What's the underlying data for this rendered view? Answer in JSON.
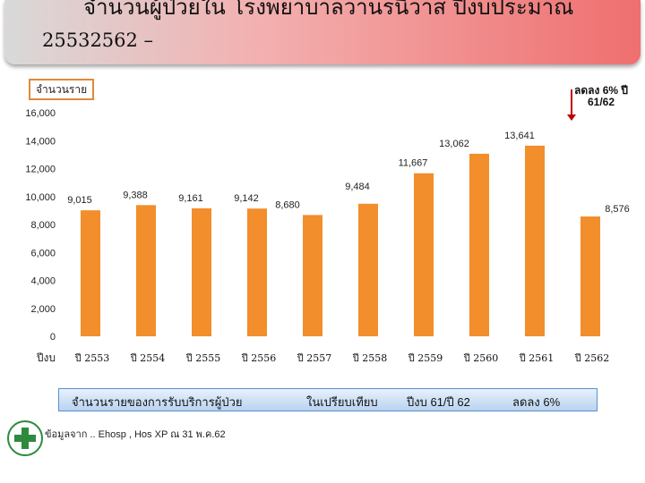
{
  "title": {
    "line1": "จำนวนผู้ป่วยใน          โรงพยาบาลวานรนิวาส   ปีงบประมาณ",
    "line2": "25532562 –"
  },
  "note": {
    "text": "ลดลง 6% ปี 61/62",
    "color": "#c00000"
  },
  "legend_text": {
    "part1": "จำนวนรายของการรับบริการผู้ป่วย",
    "part2": "ในเปรียบเทียบ",
    "part3": "ปีงบ 61/ปี 62",
    "part4": "ลดลง 6%"
  },
  "footer": {
    "source": "ข้อมูลจาก .. Ehosp , Hos XP ณ 31 พ.ค.62"
  },
  "chart_data": {
    "type": "bar",
    "ylabel": "จำนวนราย",
    "xlabel": "ปีงบ",
    "ylim": [
      0,
      16000
    ],
    "yticks": [
      "0",
      "2,000",
      "4,000",
      "6,000",
      "8,000",
      "10,000",
      "12,000",
      "14,000",
      "16,000"
    ],
    "ytick_values": [
      0,
      2000,
      4000,
      6000,
      8000,
      10000,
      12000,
      14000,
      16000
    ],
    "categories": [
      "ปี 2553",
      "ปี 2554",
      "ปี 2555",
      "ปี 2556",
      "ปี 2557",
      "ปี 2558",
      "ปี 2559",
      "ปี 2560",
      "ปี 2561",
      "ปี 2562"
    ],
    "values": [
      9015,
      9388,
      9161,
      9142,
      8680,
      9484,
      11667,
      13062,
      13641,
      8576
    ],
    "value_labels": [
      "9,015",
      "9,388",
      "9,161",
      "9,142",
      "8,680",
      "9,484",
      "11,667",
      "13,062",
      "13,641",
      "8,576"
    ],
    "bar_color": "#f28e2b",
    "grid": false
  }
}
